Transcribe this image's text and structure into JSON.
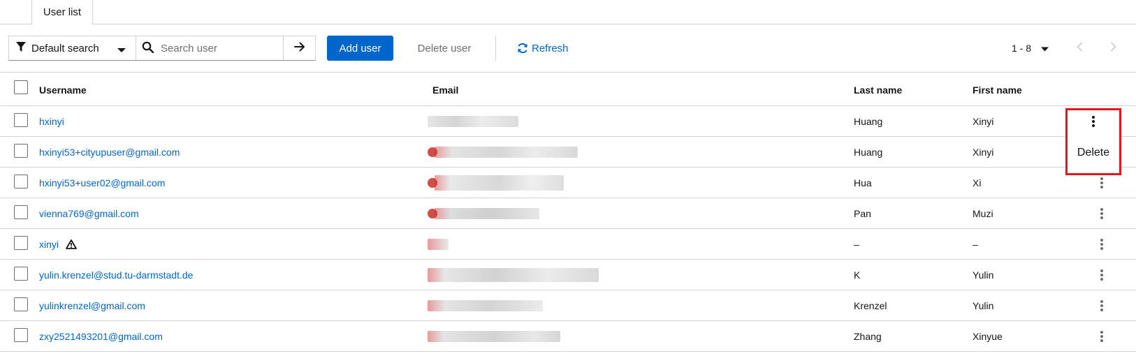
{
  "tabs": [
    {
      "label": "User list"
    }
  ],
  "toolbar": {
    "filter_label": "Default search",
    "search_placeholder": "Search user",
    "add_user_label": "Add user",
    "delete_user_label": "Delete user",
    "refresh_label": "Refresh"
  },
  "pagination": {
    "range": "1 - 8"
  },
  "table": {
    "headers": {
      "username": "Username",
      "email": "Email",
      "last_name": "Last name",
      "first_name": "First name"
    },
    "rows": [
      {
        "username": "hxinyi",
        "last_name": "Huang",
        "first_name": "Xinyi",
        "warning": false
      },
      {
        "username": "hxinyi53+cityupuser@gmail.com",
        "last_name": "Huang",
        "first_name": "Xinyi",
        "warning": false
      },
      {
        "username": "hxinyi53+user02@gmail.com",
        "last_name": "Hua",
        "first_name": "Xi",
        "warning": false
      },
      {
        "username": "vienna769@gmail.com",
        "last_name": "Pan",
        "first_name": "Muzi",
        "warning": false
      },
      {
        "username": "xinyi",
        "last_name": "–",
        "first_name": "–",
        "warning": true
      },
      {
        "username": "yulin.krenzel@stud.tu-darmstadt.de",
        "last_name": "K",
        "first_name": "Yulin",
        "warning": false
      },
      {
        "username": "yulinkrenzel@gmail.com",
        "last_name": "Krenzel",
        "first_name": "Yulin",
        "warning": false
      },
      {
        "username": "zxy2521493201@gmail.com",
        "last_name": "Zhang",
        "first_name": "Xinyue",
        "warning": false
      }
    ]
  },
  "row_menu": {
    "delete_label": "Delete"
  },
  "colors": {
    "primary": "#0066cc",
    "highlight_border": "#e8141b"
  },
  "icons": [
    "filter-icon",
    "caret-down-icon",
    "search-icon",
    "arrow-right-icon",
    "sync-icon",
    "angle-left-icon",
    "angle-right-icon",
    "kebab-icon",
    "warning-triangle-icon"
  ]
}
